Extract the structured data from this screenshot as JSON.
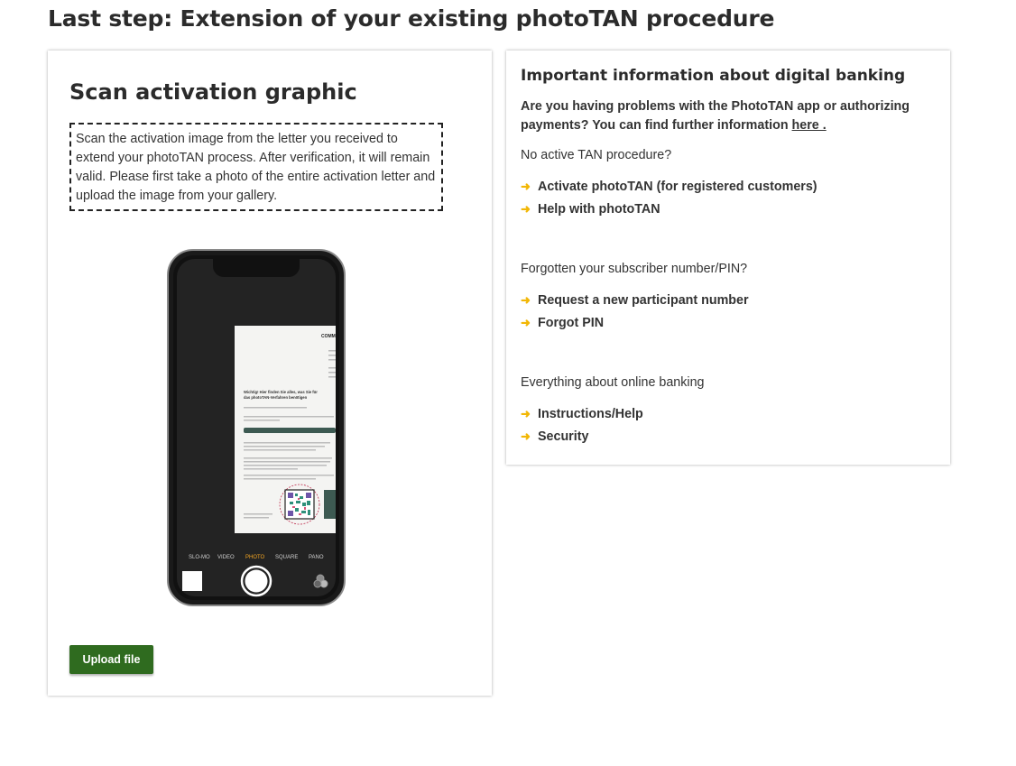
{
  "page": {
    "title": "Last step: Extension of your existing photoTAN procedure"
  },
  "scan": {
    "heading": "Scan activation graphic",
    "instructions": "Scan the activation image from the letter you received to extend your photoTAN process. After verification, it will remain valid. Please first take a photo of the entire activation letter and upload the image from your gallery.",
    "camera_modes": [
      "SLO-MO",
      "VIDEO",
      "PHOTO",
      "SQUARE",
      "PANO"
    ],
    "camera_active_mode": "PHOTO",
    "letter_brand": "COMM",
    "letter_heading": "Wichtig! Hier finden Sie alles, was Sie für das photoTAN-Verfahren benötigen",
    "upload_label": "Upload file"
  },
  "info": {
    "heading": "Important information about digital banking",
    "problem_text": "Are you having problems with the PhotoTAN app or authorizing payments? You can find further information",
    "problem_link": "here .",
    "sections": [
      {
        "label": "No active TAN procedure?",
        "links": [
          "Activate photoTAN (for registered customers)",
          "Help with photoTAN"
        ]
      },
      {
        "label": "Forgotten your subscriber number/PIN?",
        "links": [
          "Request a new participant number",
          "Forgot PIN"
        ]
      },
      {
        "label": "Everything about online banking",
        "links": [
          "Instructions/Help",
          "Security"
        ]
      }
    ]
  },
  "colors": {
    "button_green": "#2f6b1f",
    "arrow_yellow": "#f2b705",
    "camera_active": "#f5a623"
  },
  "icons": {
    "link_arrow": "arrow-right-icon",
    "shutter": "shutter-icon"
  }
}
